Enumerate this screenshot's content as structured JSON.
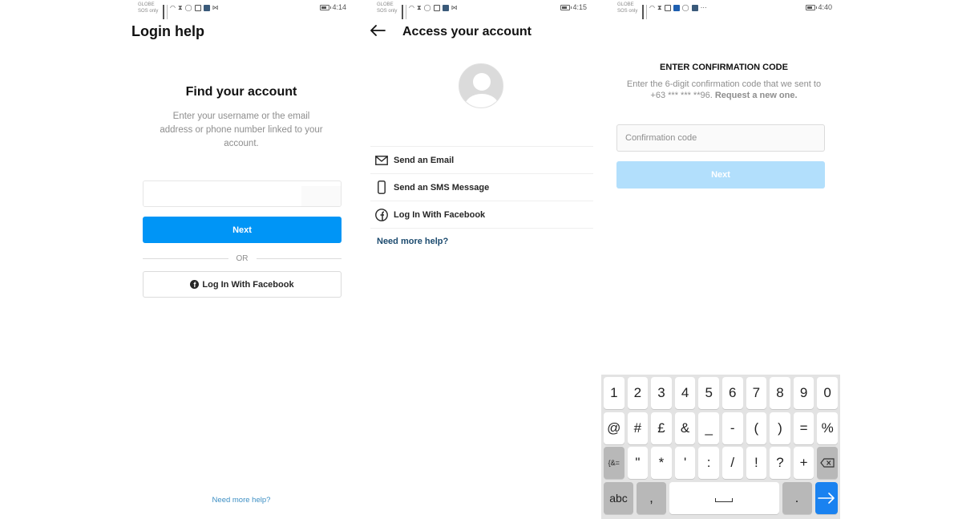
{
  "screens": [
    {
      "status": {
        "carrier_line1": "GLOBE",
        "carrier_line2": "SOS only",
        "time": "4:14"
      },
      "title": "Login help",
      "heading": "Find your account",
      "description": "Enter your username or the email address or phone number linked to your account.",
      "input": {
        "value": "",
        "placeholder": ""
      },
      "next_label": "Next",
      "or_label": "OR",
      "facebook_label": "Log In With Facebook",
      "help_link": "Need more help?"
    },
    {
      "status": {
        "carrier_line1": "GLOBE",
        "carrier_line2": "SOS only",
        "time": "4:15"
      },
      "back_icon": "arrow-left-icon",
      "title": "Access your account",
      "avatar_icon": "default-avatar-icon",
      "options": [
        {
          "icon": "mail-icon",
          "label": "Send an Email"
        },
        {
          "icon": "phone-icon",
          "label": "Send an SMS Message"
        },
        {
          "icon": "facebook-icon",
          "label": "Log In With Facebook"
        }
      ],
      "help_link": "Need more help?"
    },
    {
      "status": {
        "carrier_line1": "GLOBE",
        "carrier_line2": "SOS only",
        "time": "4:40"
      },
      "heading": "ENTER CONFIRMATION CODE",
      "description_prefix": "Enter the 6-digit confirmation code that we sent to",
      "phone_masked": "+63 *** *** **96.",
      "resend_link": "Request a new one.",
      "input": {
        "value": "",
        "placeholder": "Confirmation code"
      },
      "next_label": "Next",
      "keyboard": {
        "row1": [
          "1",
          "2",
          "3",
          "4",
          "5",
          "6",
          "7",
          "8",
          "9",
          "0"
        ],
        "row2": [
          "@",
          "#",
          "£",
          "&",
          "_",
          "-",
          "(",
          ")",
          "=",
          "%"
        ],
        "row3": [
          "{&=",
          "\"",
          "*",
          "'",
          ":",
          "/",
          "!",
          "?",
          "+",
          "backspace"
        ],
        "row4": [
          "abc",
          ",",
          "space",
          ".",
          "enter"
        ]
      }
    }
  ],
  "colors": {
    "primary_blue": "#0095f6",
    "disabled_blue": "#b2dffc",
    "link_dark": "#1b4a6e",
    "link_light": "#3d8fc4",
    "keyboard_enter": "#1a82f0"
  }
}
